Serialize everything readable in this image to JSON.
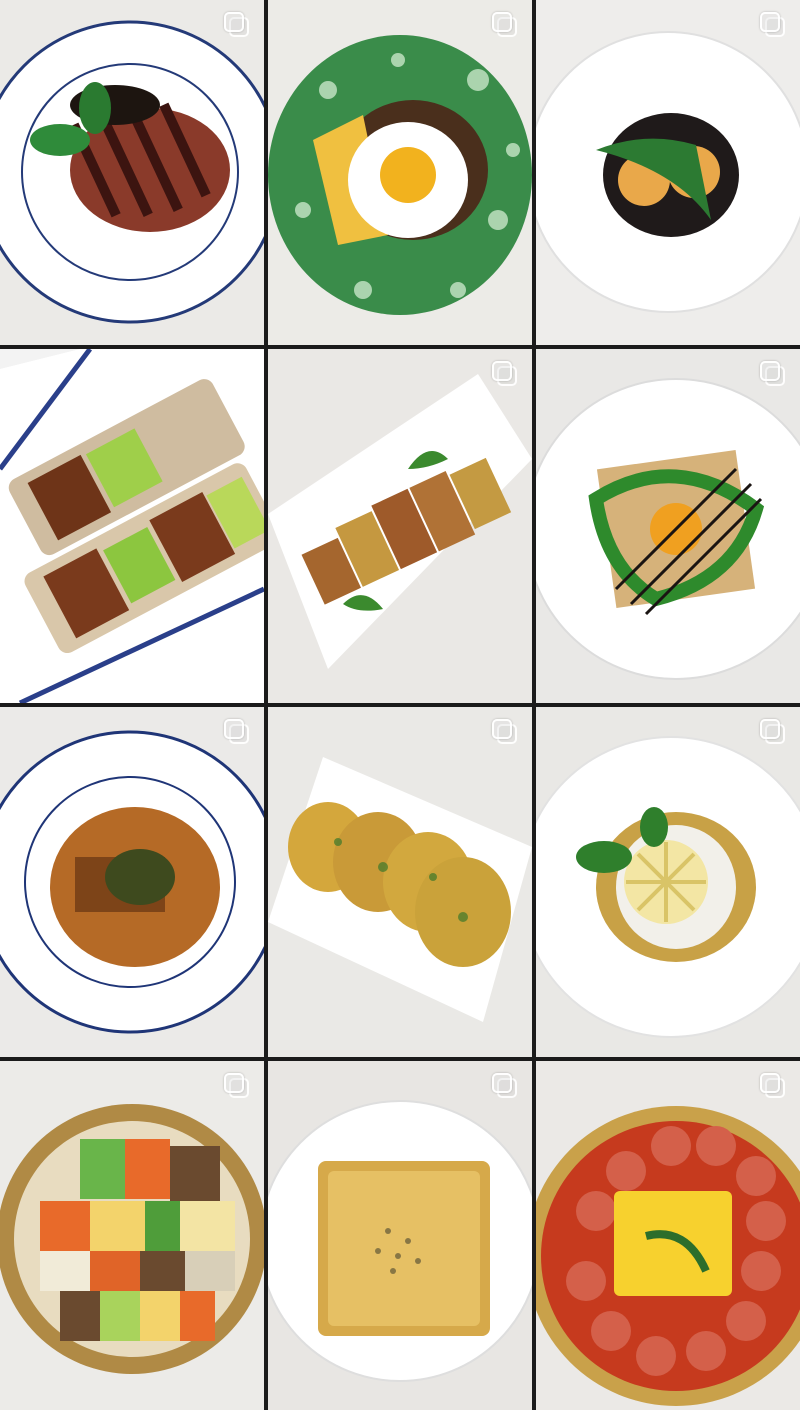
{
  "grid": {
    "posts": [
      {
        "dish": "steak-rice-bowl",
        "multi_icon": "carousel-icon"
      },
      {
        "dish": "fried-egg-noodles",
        "multi_icon": "carousel-icon"
      },
      {
        "dish": "potato-black-rice",
        "multi_icon": "carousel-icon"
      },
      {
        "dish": "rice-paper-rolls",
        "multi_icon": "none"
      },
      {
        "dish": "stuffed-tofu-slices",
        "multi_icon": "carousel-icon"
      },
      {
        "dish": "spinach-galette",
        "multi_icon": "carousel-icon"
      },
      {
        "dish": "braised-fish-curry",
        "multi_icon": "carousel-icon"
      },
      {
        "dish": "vegetable-pancakes",
        "multi_icon": "carousel-icon"
      },
      {
        "dish": "chrysanthemum-noodle-soup",
        "multi_icon": "carousel-icon"
      },
      {
        "dish": "bibimbap",
        "multi_icon": "carousel-icon"
      },
      {
        "dish": "cheese-toast",
        "multi_icon": "carousel-icon"
      },
      {
        "dish": "sausage-stew",
        "multi_icon": "carousel-icon"
      }
    ]
  }
}
